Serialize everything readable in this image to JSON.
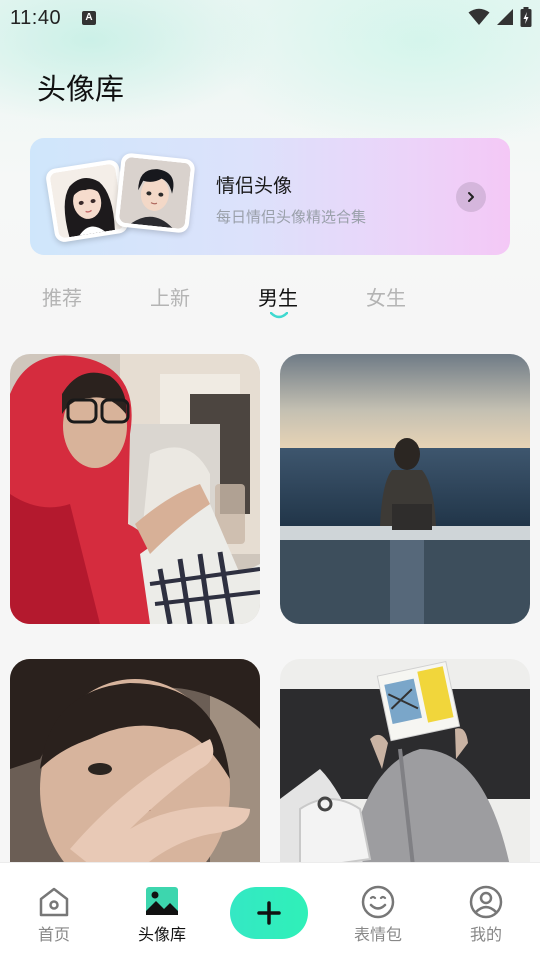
{
  "status_bar": {
    "time": "11:40",
    "notification_icon": "A"
  },
  "header": {
    "title": "头像库"
  },
  "banner": {
    "title": "情侣头像",
    "subtitle": "每日情侣头像精选合集"
  },
  "tabs": [
    {
      "label": "推荐",
      "active": false
    },
    {
      "label": "上新",
      "active": false
    },
    {
      "label": "男生",
      "active": true
    },
    {
      "label": "女生",
      "active": false
    }
  ],
  "grid": {
    "items": [
      {
        "name": "red-hoodie-glasses-photo"
      },
      {
        "name": "man-by-sea-photo"
      },
      {
        "name": "peace-sign-photo"
      },
      {
        "name": "magazine-face-photo"
      }
    ]
  },
  "bottom_nav": {
    "items": [
      {
        "label": "首页",
        "icon": "home-icon",
        "active": false
      },
      {
        "label": "头像库",
        "icon": "gallery-icon",
        "active": true
      },
      {
        "label": "",
        "icon": "plus-icon",
        "active": false
      },
      {
        "label": "表情包",
        "icon": "emoji-icon",
        "active": false
      },
      {
        "label": "我的",
        "icon": "profile-icon",
        "active": false
      }
    ]
  },
  "colors": {
    "accent": "#2fe9c0",
    "tab_indicator": "#3fd9d0",
    "inactive_text": "#b4b4b4"
  }
}
